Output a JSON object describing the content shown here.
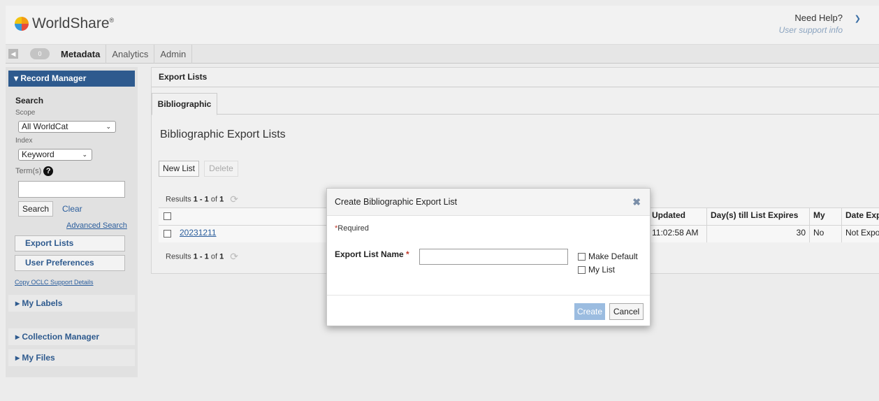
{
  "header": {
    "logo": "WorldShare",
    "help_title": "Need Help?",
    "help_sub": "User support info"
  },
  "nav": {
    "badge": "0",
    "tabs": [
      "Metadata",
      "Analytics",
      "Admin"
    ]
  },
  "sidebar": {
    "record_manager": "▾ Record Manager",
    "search_heading": "Search",
    "scope_label": "Scope",
    "scope_value": "All WorldCat",
    "index_label": "Index",
    "index_value": "Keyword",
    "terms_label": "Term(s)",
    "search_button": "Search",
    "clear_link": "Clear",
    "advanced_link": "Advanced Search",
    "export_lists": "Export Lists",
    "user_prefs": "User Preferences",
    "copy_support": "Copy OCLC Support Details",
    "my_labels": "▸ My Labels",
    "collection_manager": "▸ Collection Manager",
    "my_files": "▸ My Files"
  },
  "main": {
    "title": "Export Lists",
    "tab": "Bibliographic",
    "heading": "Bibliographic Export Lists",
    "new_list": "New List",
    "delete": "Delete",
    "results_prefix": "Results ",
    "results_range": "1 - 1",
    "results_of": " of ",
    "results_total": "1",
    "table": {
      "headers": [
        "Updated",
        "Day(s) till List Expires",
        "My List",
        "Date Exp"
      ],
      "row": {
        "name": "20231211",
        "updated": "11:02:58 AM",
        "days": "30",
        "my_list": "No",
        "date_exp": "Not Expo"
      }
    }
  },
  "modal": {
    "title": "Create Bibliographic Export List",
    "required": "Required",
    "name_label": "Export List Name",
    "name_value": "",
    "make_default": "Make Default",
    "my_list": "My List",
    "create": "Create",
    "cancel": "Cancel"
  }
}
